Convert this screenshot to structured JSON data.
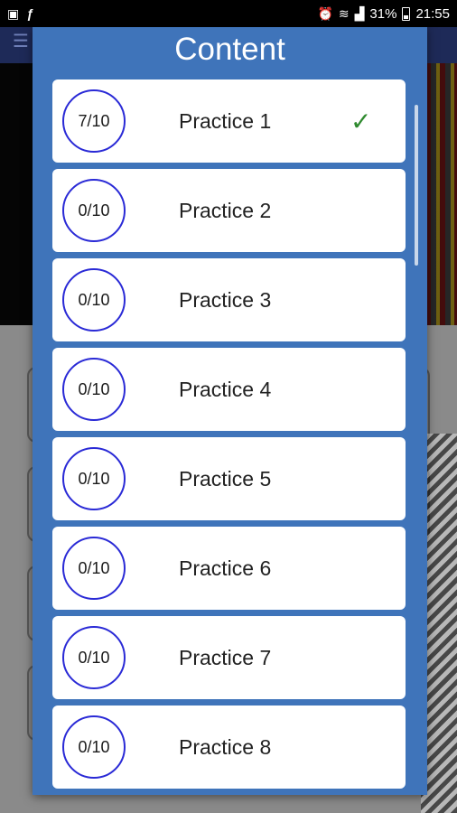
{
  "status_bar": {
    "battery_percent": "31%",
    "time": "21:55",
    "left_icons": [
      "screenshot-icon",
      "f-icon"
    ],
    "right_icons": [
      "alarm-icon",
      "wifi-icon",
      "signal-icon",
      "battery-icon"
    ]
  },
  "dialog": {
    "title": "Content",
    "items": [
      {
        "score": "7/10",
        "label": "Practice 1",
        "completed": true,
        "check": "✓"
      },
      {
        "score": "0/10",
        "label": "Practice 2",
        "completed": false
      },
      {
        "score": "0/10",
        "label": "Practice 3",
        "completed": false
      },
      {
        "score": "0/10",
        "label": "Practice 4",
        "completed": false
      },
      {
        "score": "0/10",
        "label": "Practice 5",
        "completed": false
      },
      {
        "score": "0/10",
        "label": "Practice 6",
        "completed": false
      },
      {
        "score": "0/10",
        "label": "Practice 7",
        "completed": false
      },
      {
        "score": "0/10",
        "label": "Practice 8",
        "completed": false
      }
    ]
  },
  "colors": {
    "dialog_bg": "#3f74ba",
    "circle_border": "#2a2ad6",
    "check": "#2f8a2f"
  }
}
